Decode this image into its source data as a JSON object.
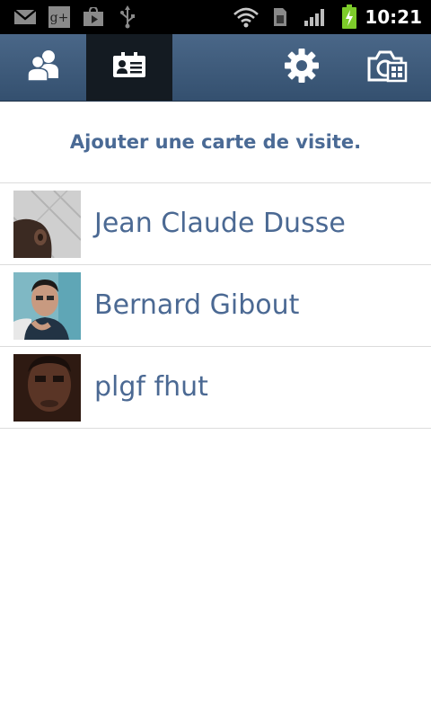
{
  "status_bar": {
    "time": "10:21",
    "icons": [
      "gmail-icon",
      "google-plus-icon",
      "play-store-icon",
      "usb-icon",
      "wifi-icon",
      "sim-icon",
      "signal-icon",
      "battery-charging-icon"
    ]
  },
  "action_bar": {
    "tabs": [
      {
        "name": "contacts-tab",
        "icon": "contacts-icon"
      },
      {
        "name": "business-cards-tab",
        "icon": "business-card-icon"
      }
    ],
    "actions": [
      {
        "name": "settings-button",
        "icon": "gear-icon"
      },
      {
        "name": "scan-card-button",
        "icon": "camera-icon"
      }
    ]
  },
  "header": {
    "add_card_label": "Ajouter une carte de visite."
  },
  "contacts": [
    {
      "name": "Jean Claude Dusse"
    },
    {
      "name": "Bernard Gibout"
    },
    {
      "name": "plgf fhut"
    }
  ]
}
